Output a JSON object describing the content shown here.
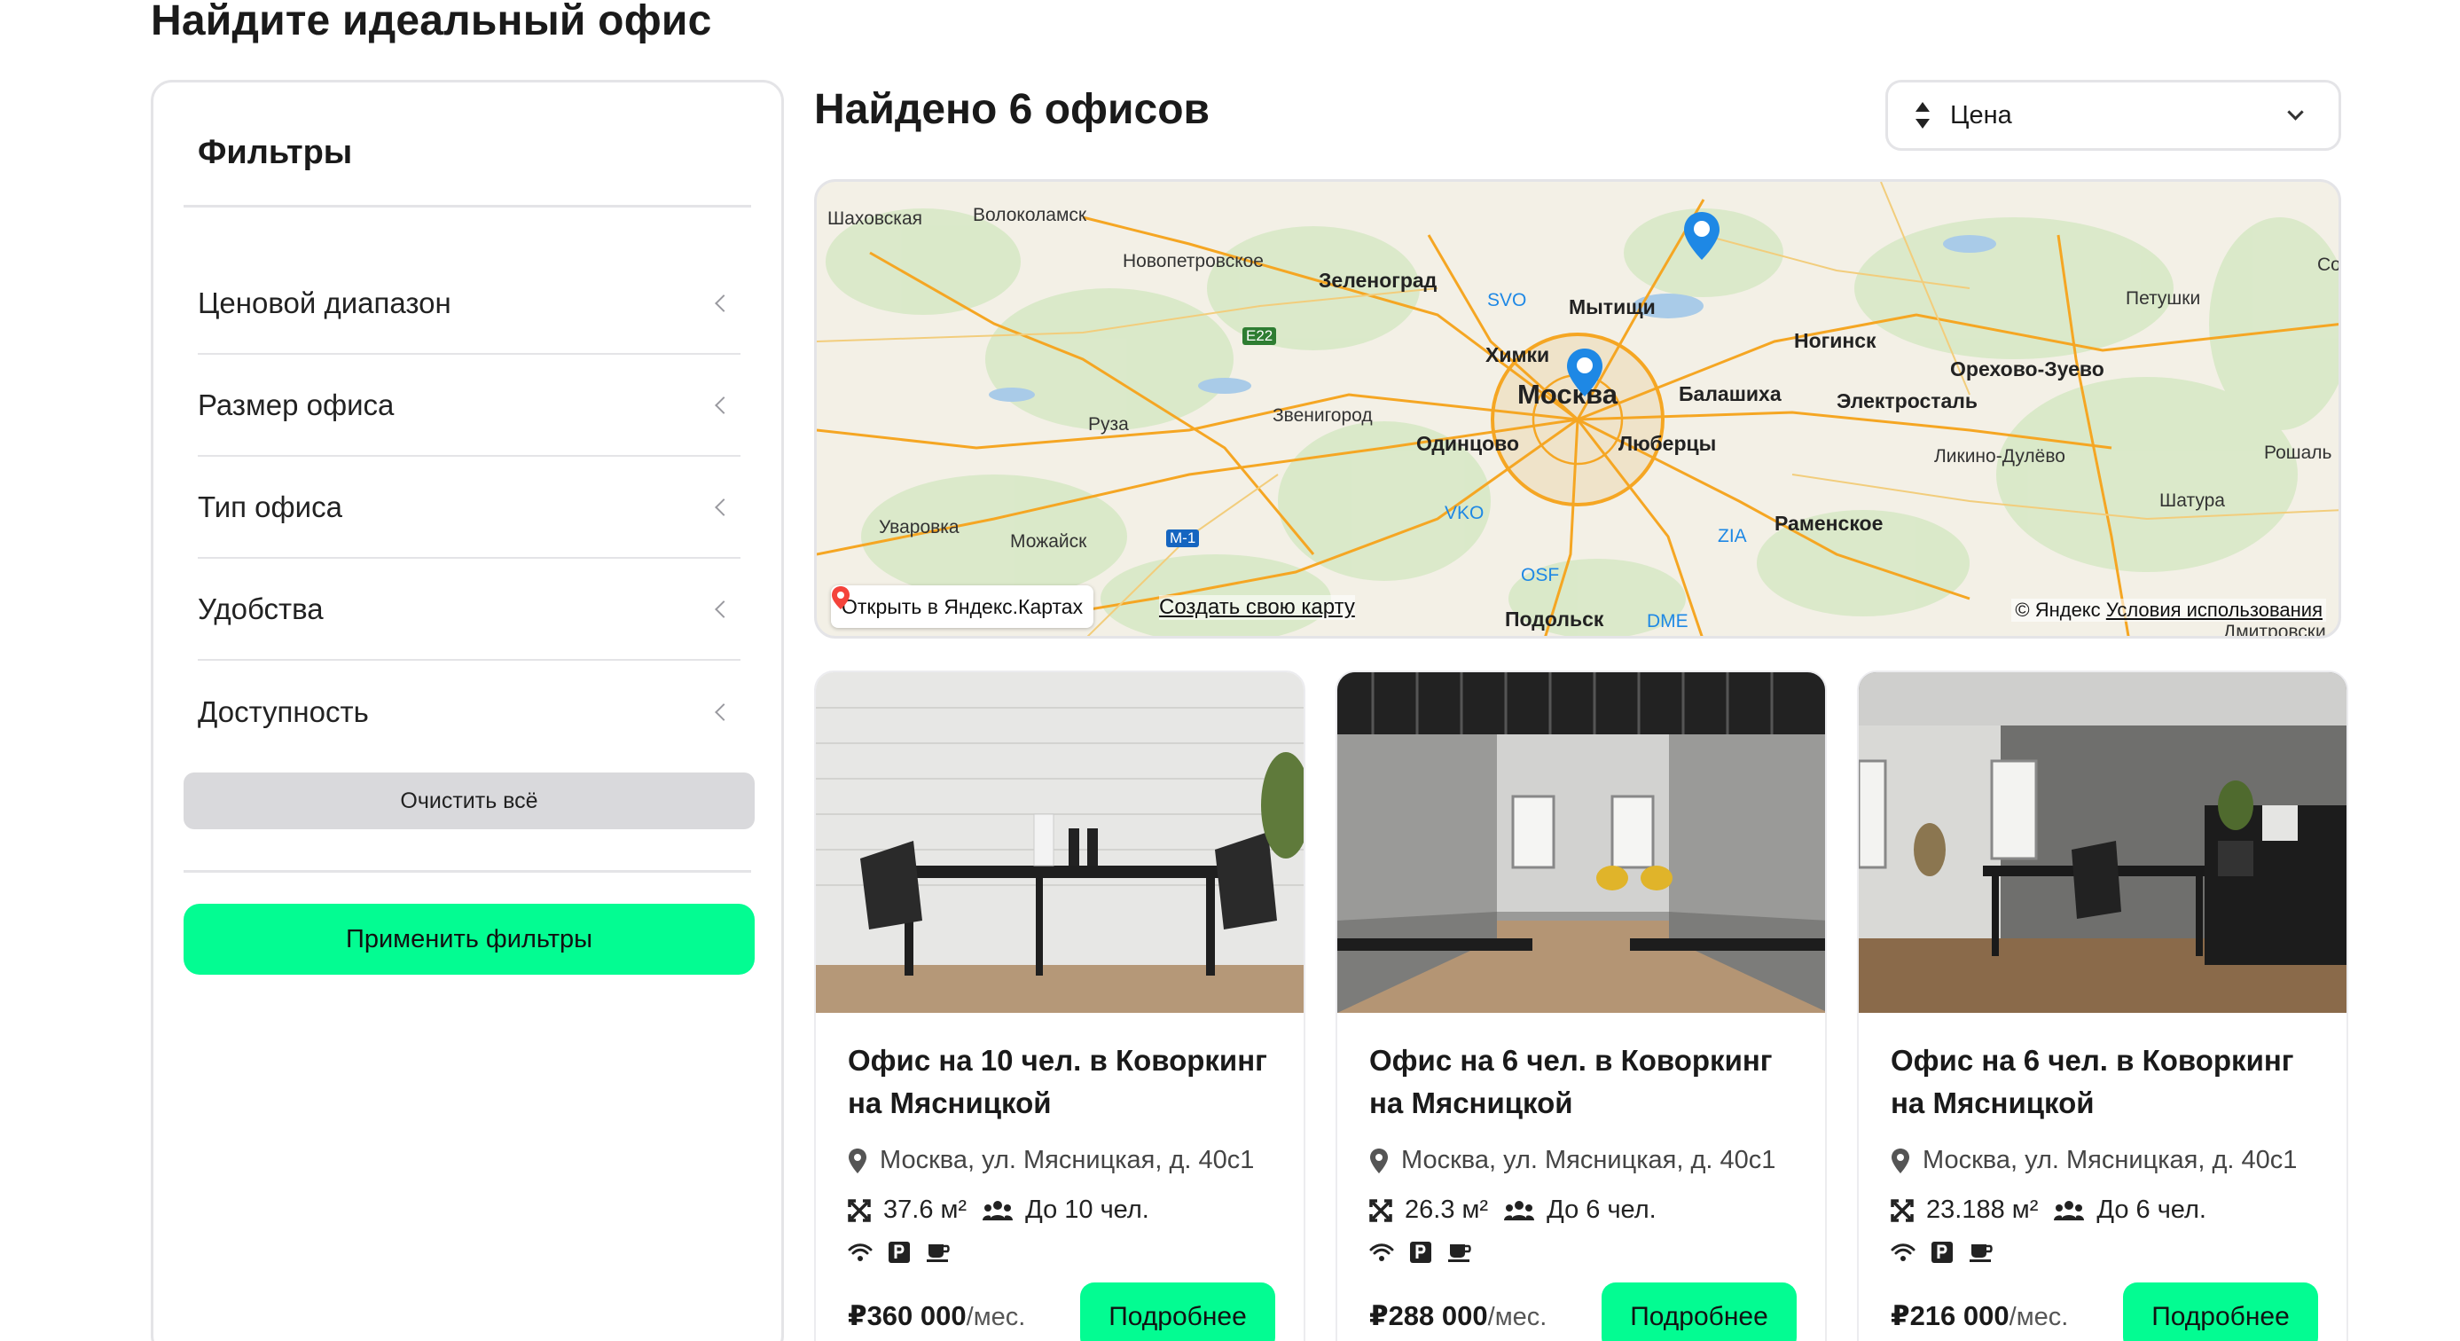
{
  "page": {
    "title": "Найдите идеальный офис"
  },
  "sidebar": {
    "title": "Фильтры",
    "filters": [
      {
        "label": "Ценовой диапазон"
      },
      {
        "label": "Размер офиса"
      },
      {
        "label": "Тип офиса"
      },
      {
        "label": "Удобства"
      },
      {
        "label": "Доступность"
      }
    ],
    "clear_label": "Очистить всё",
    "apply_label": "Применить фильтры"
  },
  "results": {
    "title": "Найдено 6 офисов",
    "sort": {
      "value": "Цена"
    }
  },
  "map": {
    "labels": {
      "shakhovskaya": "Шаховская",
      "volokolamsk": "Волоколамск",
      "novopetrovskoe": "Новопетровское",
      "zelenograd": "Зеленоград",
      "svo": "SVO",
      "mytishchi": "Мытищи",
      "khimki": "Химки",
      "moskva": "Москва",
      "balashikha": "Балашиха",
      "noginsk": "Ногинск",
      "orekhovo": "Орехово-Зуево",
      "elektrostal": "Электросталь",
      "petushki": "Петушки",
      "sob": "Соб",
      "e22": "E22",
      "ruza": "Руза",
      "zvenigorod": "Звенигород",
      "odintsovo": "Одинцово",
      "lyubertsy": "Люберцы",
      "likino": "Ликино-Дулёво",
      "roshal": "Рошаль",
      "shatura": "Шатура",
      "uvarovka": "Уваровка",
      "mozhaysk": "Можайск",
      "m1": "M-1",
      "vko": "VKO",
      "zia": "ZIA",
      "ramenskoe": "Раменское",
      "osf": "OSF",
      "dme": "DME",
      "podolsk": "Подольск",
      "dmitrovsky": "Дмитровски"
    },
    "open_label": "Открыть в Яндекс.Картах",
    "create_label": "Создать свою карту",
    "copyright": "© Яндекс",
    "terms": "Условия использования"
  },
  "offices": [
    {
      "title": "Офис на 10 чел. в Коворкинг на Мясницкой",
      "address": "Москва, ул. Мясницкая, д. 40с1",
      "area": "37.6 м²",
      "capacity": "До 10 чел.",
      "price": "₽360 000",
      "period": "/мес.",
      "details_label": "Подробнее"
    },
    {
      "title": "Офис на 6 чел. в Коворкинг на Мясницкой",
      "address": "Москва, ул. Мясницкая, д. 40с1",
      "area": "26.3 м²",
      "capacity": "До 6 чел.",
      "price": "₽288 000",
      "period": "/мес.",
      "details_label": "Подробнее"
    },
    {
      "title": "Офис на 6 чел. в Коворкинг на Мясницкой",
      "address": "Москва, ул. Мясницкая, д. 40с1",
      "area": "23.188 м²",
      "capacity": "До 6 чел.",
      "price": "₽216 000",
      "period": "/мес.",
      "details_label": "Подробнее"
    }
  ],
  "colors": {
    "accent": "#03fc92",
    "border": "#e4e4e7",
    "map_pin": "#1e88e5",
    "map_road": "#f5a623"
  }
}
